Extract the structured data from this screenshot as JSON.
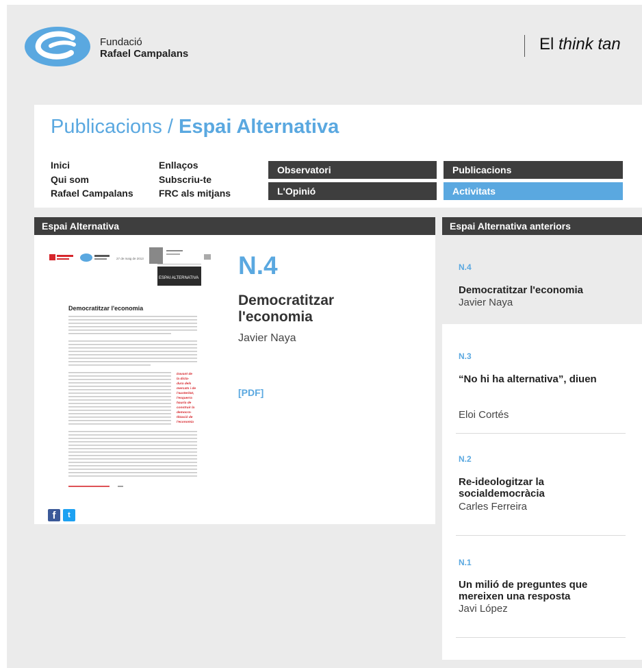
{
  "org": {
    "line1": "Fundació",
    "line2": "Rafael Campalans"
  },
  "tagline": {
    "pre": "El ",
    "em": "think tan"
  },
  "page_title": {
    "lead": "Publicacions / ",
    "strong": "Espai Alternativa"
  },
  "links_col1": [
    "Inici",
    "Qui som",
    "Rafael Campalans"
  ],
  "links_col2": [
    "Enllaços",
    "Subscriu-te",
    "FRC als mitjans"
  ],
  "nav": {
    "observatori": "Observatori",
    "opinio": "L'Opinió",
    "publicacions": "Publicacions",
    "activitats": "Activitats"
  },
  "section_left": "Espai Alternativa",
  "section_right": "Espai Alternativa anteriors",
  "main": {
    "issue": "N.4",
    "title": "Democratitzar l'economia",
    "author": "Javier Naya",
    "pdf": "[PDF]"
  },
  "thumb": {
    "date": "27 de maig de 2013",
    "heading": "Democratitzar l'economia",
    "masthead": "ESPAI ALTERNATIVA",
    "quote": "Davant de la dictadura dels mercats i de l'austeritat, l'esquerra hauria de construir la democratització de l'economia"
  },
  "previous": [
    {
      "num": "N.4",
      "title": "Democratitzar l'economia",
      "author": "Javier Naya"
    },
    {
      "num": "N.3",
      "title": "“No hi ha alternativa”, diuen",
      "author": "Eloi Cortés"
    },
    {
      "num": "N.2",
      "title": "Re-ideologitzar la socialdemocràcia",
      "author": "Carles Ferreira"
    },
    {
      "num": "N.1",
      "title": "Un milió de preguntes que mereixen una resposta",
      "author": "Javi López"
    }
  ],
  "colors": {
    "accent": "#5aa8e0",
    "dark": "#3e3e3e",
    "bg": "#ebebeb"
  }
}
